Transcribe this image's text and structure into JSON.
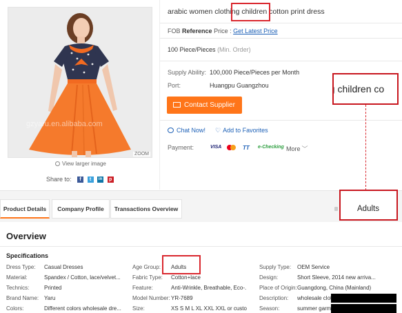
{
  "product": {
    "title": "arabic women clothing children cotton print dress",
    "fob_label": "FOB",
    "fob_reference": "Reference",
    "fob_price_label": "Price :",
    "fob_link": "Get Latest Price",
    "moq_value": "100 Piece/Pieces",
    "moq_unit": "(Min. Order)",
    "supply_ability_label": "Supply Ability:",
    "supply_ability_value": "100,000 Piece/Pieces per Month",
    "port_label": "Port:",
    "port_value": "Huangpu Guangzhou",
    "contact_button": "Contact Supplier",
    "chat_now": "Chat Now!",
    "add_favorites": "Add to Favorites",
    "payment_label": "Payment:",
    "payment_methods": [
      "VISA",
      "MC",
      "TT",
      "e-Checking"
    ],
    "more_label": "More",
    "view_larger": "View larger image",
    "share_label": "Share to:",
    "share_icons": [
      "f",
      "t",
      "in",
      "p"
    ],
    "zoom_tag": "ZOOM",
    "watermark": "gzyaru.en.alibaba.com"
  },
  "callouts": {
    "zoom_text": "ng children co",
    "adults_text": "Adults"
  },
  "tabs": [
    "Product Details",
    "Company Profile",
    "Transactions Overview"
  ],
  "overview_title": "Overview",
  "specs_title": "Specifications",
  "specs": {
    "col1": [
      {
        "label": "Dress Type:",
        "value": "Casual Dresses"
      },
      {
        "label": "Material:",
        "value": "Spandex / Cotton, lace/velvet..."
      },
      {
        "label": "Technics:",
        "value": "Printed"
      },
      {
        "label": "Brand Name:",
        "value": "Yaru"
      },
      {
        "label": "Colors:",
        "value": "Different colors wholesale dre..."
      }
    ],
    "col2": [
      {
        "label": "Age Group:",
        "value": "Adults"
      },
      {
        "label": "Fabric Type:",
        "value": "Cotton+lace"
      },
      {
        "label": "Feature:",
        "value": "Anti-Wrinkle, Breathable, Eco-..."
      },
      {
        "label": "Model Number:",
        "value": "YR-7689"
      },
      {
        "label": "Size:",
        "value": "XS S M L XL XXL XXL or custo..."
      }
    ],
    "col3": [
      {
        "label": "Supply Type:",
        "value": "OEM Service"
      },
      {
        "label": "Design:",
        "value": "Short Sleeve, 2014 new arriva..."
      },
      {
        "label": "Place of Origin:",
        "value": "Guangdong, China (Mainland)"
      },
      {
        "label": "Description:",
        "value": "wholesale clot"
      },
      {
        "label": "Season:",
        "value": "summer garm"
      }
    ]
  },
  "colors": {
    "accent": "#ff7519",
    "link": "#1b5fb6",
    "highlight": "#d9262d"
  }
}
